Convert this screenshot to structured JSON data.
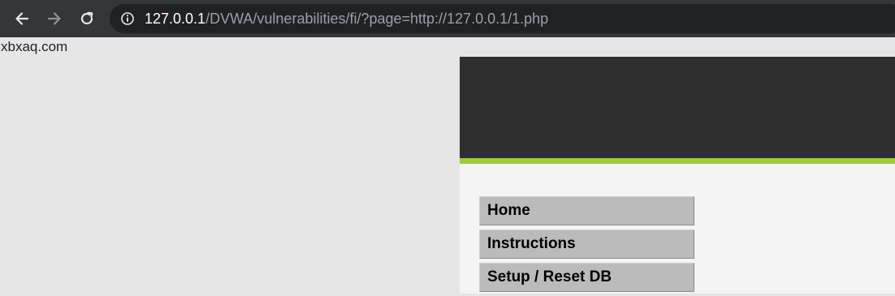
{
  "browser": {
    "url_host": "127.0.0.1",
    "url_path": "/DVWA/vulnerabilities/fi/?page=http://127.0.0.1/1.php",
    "icons": {
      "back": "arrow-left-icon",
      "forward": "arrow-right-icon",
      "reload": "reload-icon",
      "site_info": "info-icon"
    }
  },
  "page": {
    "included_text": "xbxaq.com",
    "menu_items": [
      {
        "label": "Home"
      },
      {
        "label": "Instructions"
      },
      {
        "label": "Setup / Reset DB"
      }
    ]
  },
  "colors": {
    "toolbar": "#35363a",
    "omnibox": "#202124",
    "dvwa_header": "#2f2f2f",
    "dvwa_accent": "#a0cc3c",
    "menu_item_bg": "#bcbbbb"
  }
}
